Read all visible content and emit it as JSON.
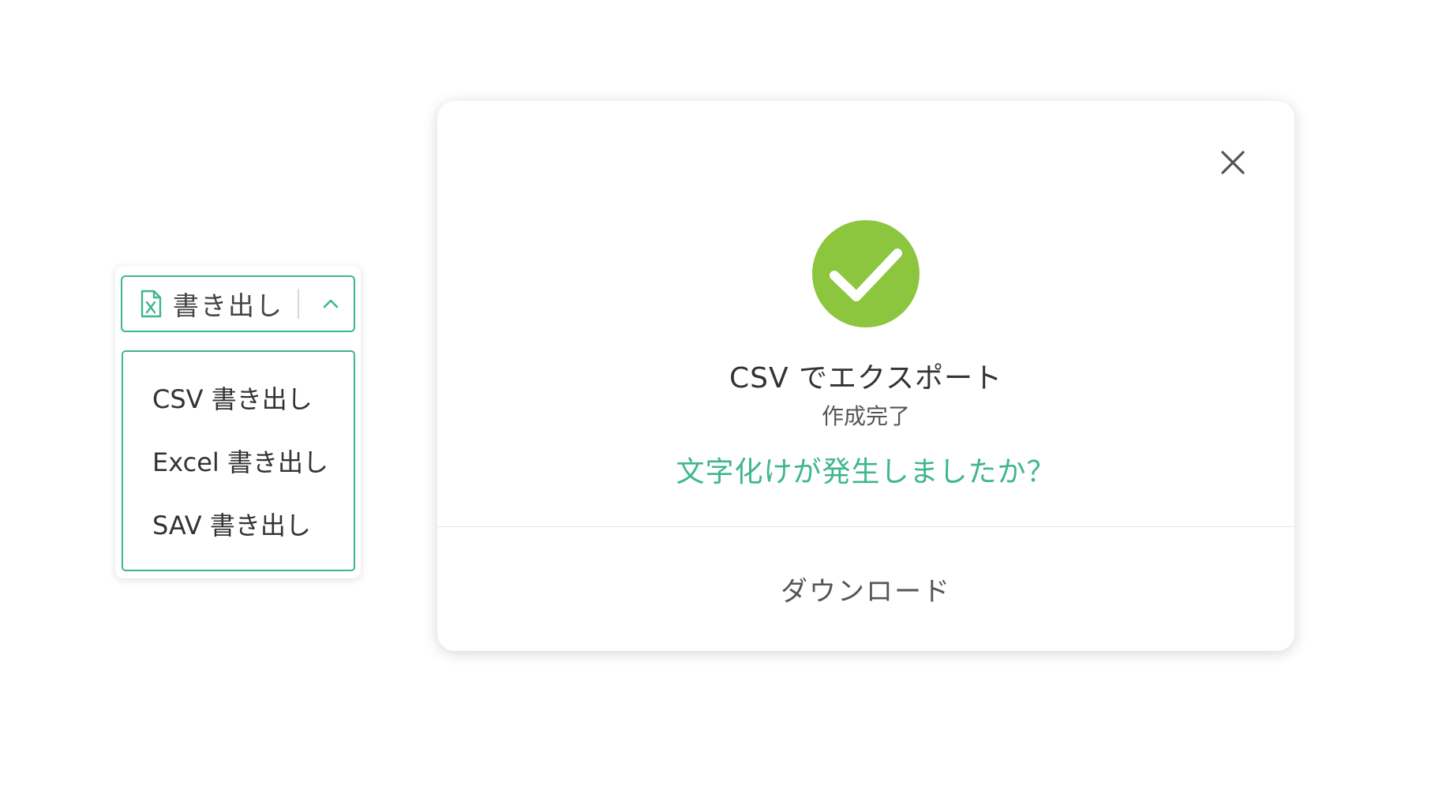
{
  "export_widget": {
    "button_label": "書き出し",
    "file_icon": "excel-file-icon",
    "chevron_icon": "chevron-up-icon",
    "menu_items": [
      {
        "label": "CSV 書き出し"
      },
      {
        "label": "Excel 書き出し"
      },
      {
        "label": "SAV 書き出し"
      }
    ]
  },
  "modal": {
    "close_icon": "close-icon",
    "status_icon": "check-circle-icon",
    "title": "CSV でエクスポート",
    "subtitle": "作成完了",
    "help_link": "文字化けが発生しましたか？",
    "download_label": "ダウンロード"
  },
  "colors": {
    "accent": "#3fb68b",
    "success": "#8cc63f",
    "text": "#333333",
    "muted_text": "#555555",
    "divider": "#e5e5e5"
  }
}
